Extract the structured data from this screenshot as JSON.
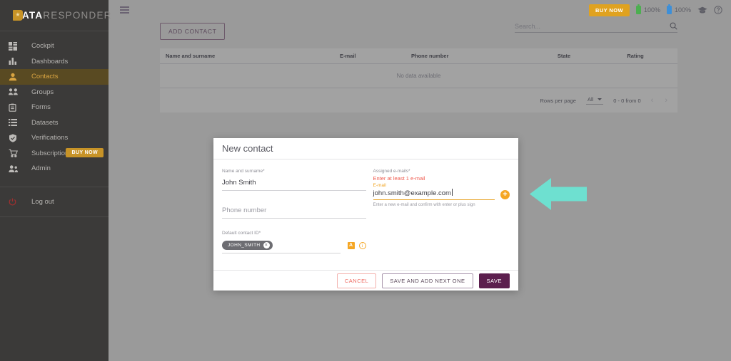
{
  "brand": {
    "name_bold": "DATA",
    "name_light": "RESPONDER",
    "logo_star": "★",
    "colors": {
      "accent_gold": "#c79327",
      "accent_purple": "#5c2d52",
      "sidebar_bg": "#3b3a39"
    }
  },
  "sidebar": {
    "items": [
      {
        "label": "Cockpit",
        "icon": "dashboard-grid-icon",
        "active": false
      },
      {
        "label": "Dashboards",
        "icon": "bar-chart-icon",
        "active": false
      },
      {
        "label": "Contacts",
        "icon": "person-icon",
        "active": true
      },
      {
        "label": "Groups",
        "icon": "people-group-icon",
        "active": false
      },
      {
        "label": "Forms",
        "icon": "clipboard-icon",
        "active": false
      },
      {
        "label": "Datasets",
        "icon": "list-icon",
        "active": false
      },
      {
        "label": "Verifications",
        "icon": "shield-check-icon",
        "active": false
      },
      {
        "label": "Subscription",
        "icon": "shopping-cart-icon",
        "active": false,
        "badge": "BUY NOW"
      },
      {
        "label": "Admin",
        "icon": "people-admin-icon",
        "active": false
      }
    ],
    "logout": {
      "label": "Log out",
      "icon": "power-icon"
    }
  },
  "topbar": {
    "menu_icon": "hamburger-menu-icon",
    "buy_now": "BUY NOW",
    "meters": [
      {
        "label": "100%",
        "color": "#4caf50",
        "icon": "battery-green-icon"
      },
      {
        "label": "100%",
        "color": "#3d8fd8",
        "icon": "battery-blue-icon"
      }
    ],
    "academy_icon": "graduation-cap-icon",
    "help_icon": "help-circle-icon"
  },
  "toolbar": {
    "add_contact": "ADD CONTACT",
    "search": {
      "placeholder": "Search...",
      "value": "",
      "icon": "search-icon"
    }
  },
  "table": {
    "columns": [
      "Name and surname",
      "E-mail",
      "Phone number",
      "State",
      "Rating"
    ],
    "empty_message": "No data available",
    "footer": {
      "rows_per_page_label": "Rows per page",
      "rows_per_page_value": "All",
      "range": "0 - 0 from 0",
      "prev_icon": "chevron-left-icon",
      "next_icon": "chevron-right-icon"
    }
  },
  "dialog": {
    "title": "New contact",
    "name_field": {
      "label": "Name and surname*",
      "value": "John Smith"
    },
    "phone_field": {
      "label": "Phone number",
      "value": "",
      "placeholder": "Phone number"
    },
    "contact_id_field": {
      "label": "Default contact ID*",
      "chip": "JOHN_SMITH",
      "chip_remove_icon": "close-circle-icon",
      "badge_letter": "A",
      "info_icon": "info-circle-icon"
    },
    "emails_field": {
      "label": "Assigned e-mails*",
      "error": "Enter at least 1 e-mail",
      "sub_label": "E-mail",
      "value": "john.smith@example.com",
      "add_icon": "plus-circle-icon",
      "hint": "Enter a new e-mail and confirm with enter or plus sign"
    },
    "buttons": {
      "cancel": "CANCEL",
      "save_and_next": "SAVE AND ADD NEXT ONE",
      "save": "SAVE"
    }
  },
  "annotation": {
    "arrow": {
      "icon": "left-arrow-annotation",
      "color": "#6ee0d0",
      "direction": "left"
    }
  }
}
